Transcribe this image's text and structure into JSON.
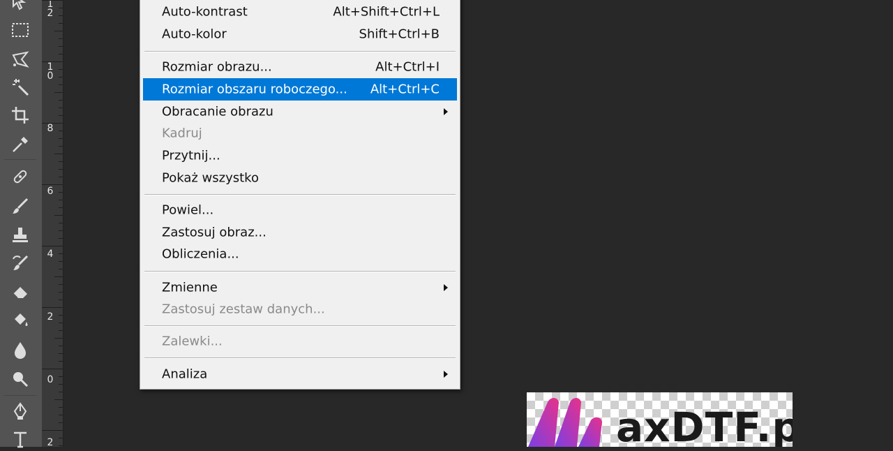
{
  "tools": [
    {
      "name": "move-tool-icon"
    },
    {
      "name": "marquee-tool-icon"
    },
    {
      "name": "lasso-tool-icon"
    },
    {
      "name": "magic-wand-tool-icon"
    },
    {
      "name": "crop-tool-icon"
    },
    {
      "name": "eyedropper-tool-icon"
    },
    {
      "name": "healing-brush-tool-icon"
    },
    {
      "name": "brush-tool-icon"
    },
    {
      "name": "clone-stamp-tool-icon"
    },
    {
      "name": "history-brush-tool-icon"
    },
    {
      "name": "eraser-tool-icon"
    },
    {
      "name": "paint-bucket-tool-icon"
    },
    {
      "name": "blur-tool-icon"
    },
    {
      "name": "dodge-tool-icon"
    },
    {
      "name": "pen-tool-icon"
    },
    {
      "name": "type-tool-icon"
    }
  ],
  "ruler": {
    "labels": [
      "12",
      "10",
      "8",
      "6",
      "4",
      "2",
      "0",
      "2"
    ]
  },
  "menu": {
    "items": [
      {
        "label": "Auto-kontrast",
        "shortcut": "Alt+Shift+Ctrl+L",
        "enabled": true
      },
      {
        "label": "Auto-kolor",
        "shortcut": "Shift+Ctrl+B",
        "enabled": true
      },
      {
        "label": "Rozmiar obrazu...",
        "shortcut": "Alt+Ctrl+I",
        "enabled": true
      },
      {
        "label": "Rozmiar obszaru roboczego...",
        "shortcut": "Alt+Ctrl+C",
        "enabled": true,
        "highlighted": true
      },
      {
        "label": "Obracanie obrazu",
        "shortcut": "",
        "enabled": true,
        "submenu": true
      },
      {
        "label": "Kadruj",
        "shortcut": "",
        "enabled": false
      },
      {
        "label": "Przytnij...",
        "shortcut": "",
        "enabled": true
      },
      {
        "label": "Pokaż wszystko",
        "shortcut": "",
        "enabled": true
      },
      {
        "label": "Powiel...",
        "shortcut": "",
        "enabled": true
      },
      {
        "label": "Zastosuj obraz...",
        "shortcut": "",
        "enabled": true
      },
      {
        "label": "Obliczenia...",
        "shortcut": "",
        "enabled": true
      },
      {
        "label": "Zmienne",
        "shortcut": "",
        "enabled": true,
        "submenu": true
      },
      {
        "label": "Zastosuj zestaw danych...",
        "shortcut": "",
        "enabled": false
      },
      {
        "label": "Zalewki...",
        "shortcut": "",
        "enabled": false
      },
      {
        "label": "Analiza",
        "shortcut": "",
        "enabled": true,
        "submenu": true
      }
    ]
  },
  "logo": {
    "text": "axDTF.pl",
    "colors": {
      "gradient_start": "#7b3fe4",
      "gradient_end": "#e8318a"
    }
  },
  "colors": {
    "highlight": "#0078d7",
    "menu_bg": "#f0f0f0",
    "canvas_bg": "#282828",
    "toolbar_bg": "#535353"
  }
}
